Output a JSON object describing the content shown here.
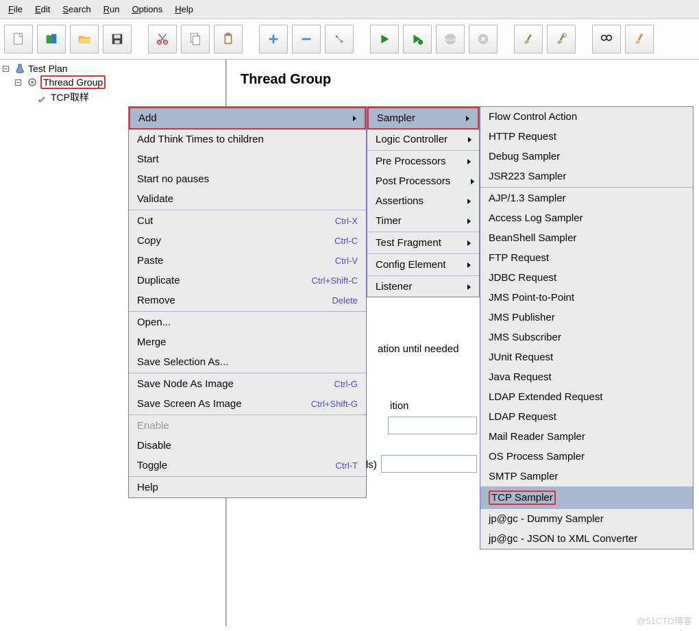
{
  "menubar": {
    "file": "File",
    "edit": "Edit",
    "search": "Search",
    "run": "Run",
    "options": "Options",
    "help": "Help"
  },
  "tree": {
    "root": "Test Plan",
    "thread_group": "Thread Group",
    "tcp": "TCP取样"
  },
  "panel": {
    "title": "Thread Group"
  },
  "ctx": {
    "add": "Add",
    "think": "Add Think Times to children",
    "start": "Start",
    "start_np": "Start no pauses",
    "validate": "Validate",
    "cut": "Cut",
    "cut_k": "Ctrl-X",
    "copy": "Copy",
    "copy_k": "Ctrl-C",
    "paste": "Paste",
    "paste_k": "Ctrl-V",
    "dup": "Duplicate",
    "dup_k": "Ctrl+Shift-C",
    "remove": "Remove",
    "remove_k": "Delete",
    "open": "Open...",
    "merge": "Merge",
    "savesel": "Save Selection As...",
    "savenode": "Save Node As Image",
    "savenode_k": "Ctrl-G",
    "savescr": "Save Screen As Image",
    "savescr_k": "Ctrl+Shift-G",
    "enable": "Enable",
    "disable": "Disable",
    "toggle": "Toggle",
    "toggle_k": "Ctrl-T",
    "help": "Help"
  },
  "sub": {
    "sampler": "Sampler",
    "logic": "Logic Controller",
    "pre": "Pre Processors",
    "post": "Post Processors",
    "assert": "Assertions",
    "timer": "Timer",
    "frag": "Test Fragment",
    "config": "Config Element",
    "listener": "Listener"
  },
  "samplers": {
    "flow": "Flow Control Action",
    "http": "HTTP Request",
    "debug": "Debug Sampler",
    "jsr": "JSR223 Sampler",
    "ajp": "AJP/1.3 Sampler",
    "acc": "Access Log Sampler",
    "bean": "BeanShell Sampler",
    "ftp": "FTP Request",
    "jdbc": "JDBC Request",
    "jmspp": "JMS Point-to-Point",
    "jmspub": "JMS Publisher",
    "jmssub": "JMS Subscriber",
    "junit": "JUnit Request",
    "java": "Java Request",
    "ldapex": "LDAP Extended Request",
    "ldap": "LDAP Request",
    "mail": "Mail Reader Sampler",
    "os": "OS Process Sampler",
    "smtp": "SMTP Sampler",
    "tcp": "TCP Sampler",
    "dummy": "jp@gc - Dummy Sampler",
    "json": "jp@gc - JSON to XML Converter"
  },
  "bg": {
    "ation": "ation until needed",
    "ition": "ition",
    "ds": "ds)"
  },
  "watermark": "@51CTO博客"
}
